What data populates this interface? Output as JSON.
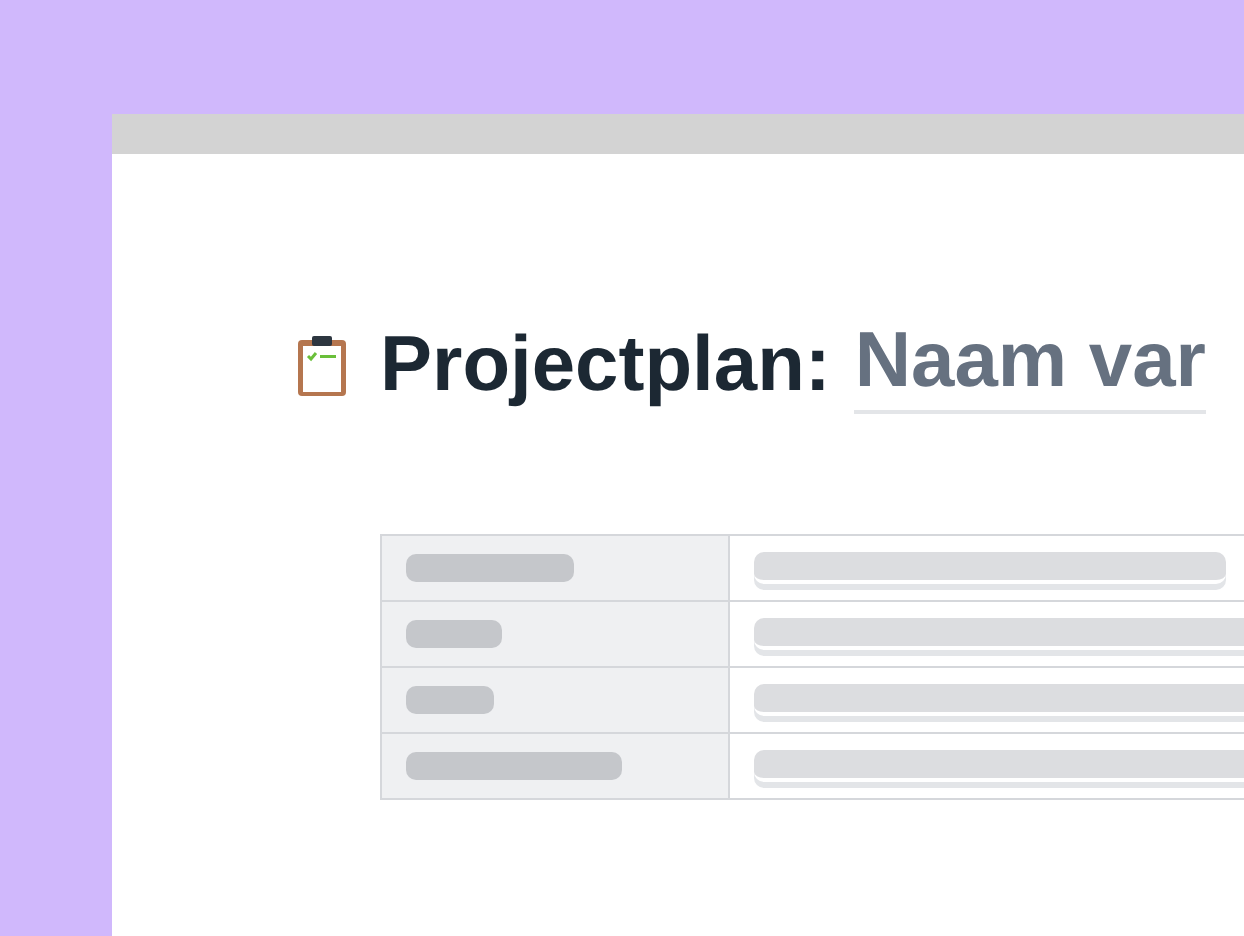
{
  "document": {
    "title": "Projectplan:",
    "title_field": {
      "value": "Naam var"
    }
  },
  "table": {
    "rows": [
      {
        "kind": "skeleton"
      },
      {
        "kind": "skeleton"
      },
      {
        "kind": "skeleton"
      },
      {
        "kind": "skeleton"
      }
    ]
  }
}
